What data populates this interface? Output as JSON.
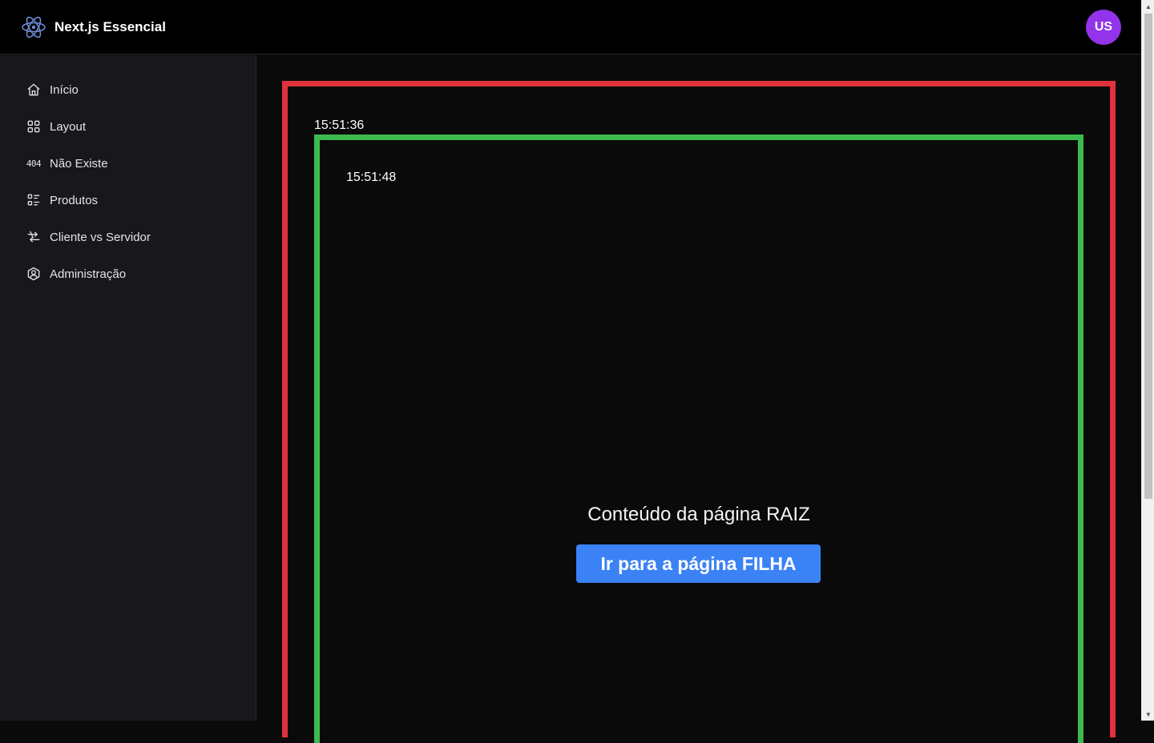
{
  "header": {
    "brand_icon": "react-atom-icon",
    "brand_title": "Next.js Essencial",
    "avatar_initials": "US",
    "avatar_color": "#9333ea"
  },
  "sidebar": {
    "items": [
      {
        "label": "Início",
        "icon": "home-icon"
      },
      {
        "label": "Layout",
        "icon": "layout-grid-icon"
      },
      {
        "label": "Não Existe",
        "icon": "404-icon",
        "icon_text": "404"
      },
      {
        "label": "Produtos",
        "icon": "list-details-icon"
      },
      {
        "label": "Cliente vs Servidor",
        "icon": "arrows-transfer-icon"
      },
      {
        "label": "Administração",
        "icon": "user-hexagon-icon"
      }
    ]
  },
  "main": {
    "outer_time": "15:51:36",
    "inner_time": "15:51:48",
    "root_text": "Conteúdo da página RAIZ",
    "child_link_label": "Ir para a página FILHA",
    "outer_border_color": "#e0323c",
    "inner_border_color": "#3dba4e",
    "button_color": "#3b82f6"
  }
}
